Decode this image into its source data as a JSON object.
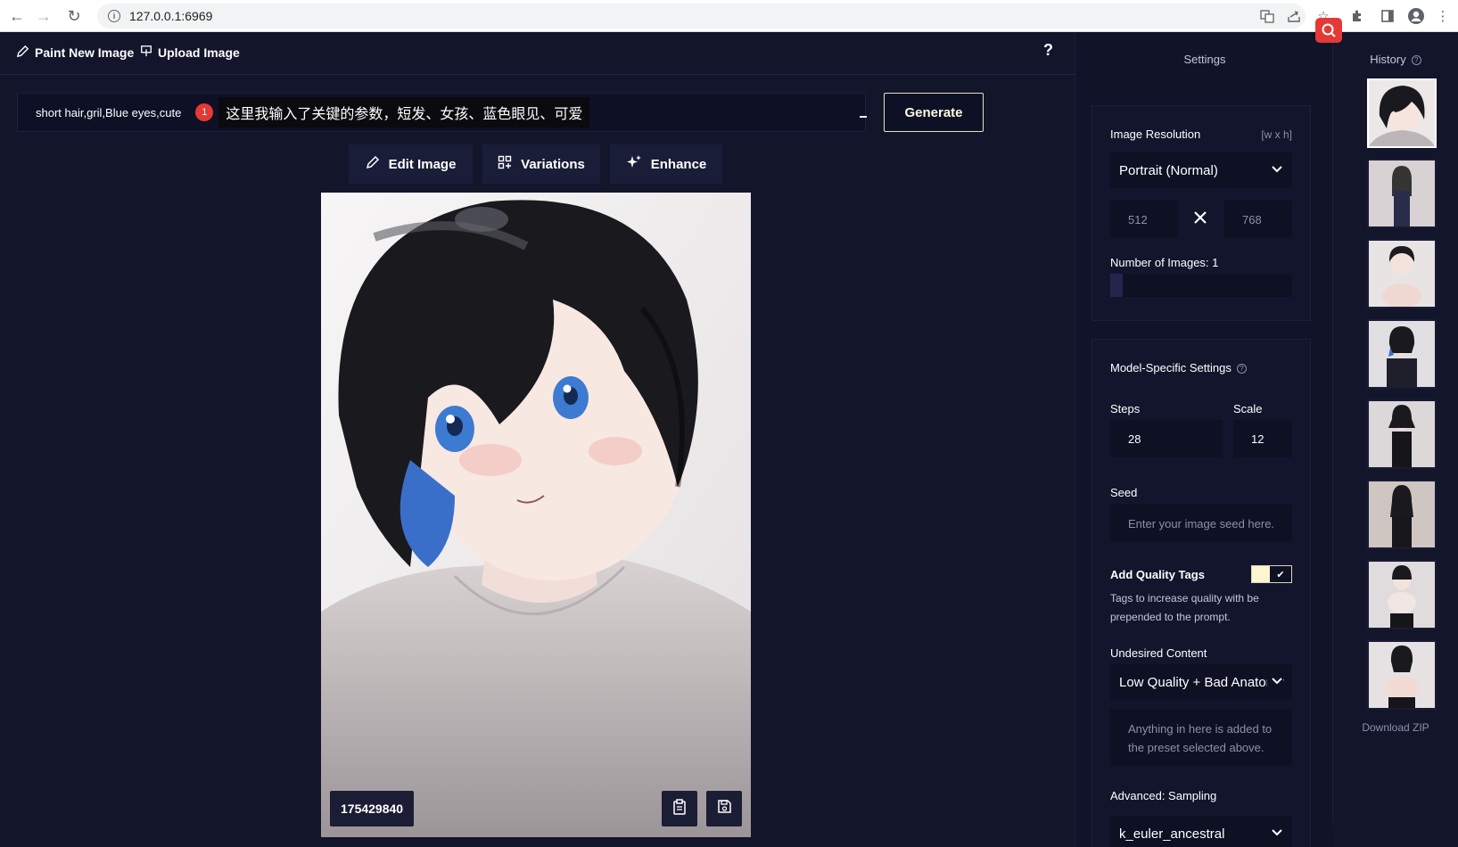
{
  "browser": {
    "url": "127.0.0.1:6969"
  },
  "topbar": {
    "paint_new_label": "Paint New Image",
    "upload_label": "Upload Image",
    "help_label": "?"
  },
  "prompt": {
    "value": "short hair,gril,Blue eyes,cute",
    "badge": "1",
    "annotation": "这里我输入了关键的参数，短发、女孩、蓝色眼见、可爱"
  },
  "generate_label": "Generate",
  "actions": {
    "edit": "Edit Image",
    "variations": "Variations",
    "enhance": "Enhance"
  },
  "image": {
    "seed": "175429840"
  },
  "settings": {
    "title": "Settings",
    "resolution": {
      "label": "Image Resolution",
      "hint": "[w x h]",
      "selected": "Portrait (Normal)",
      "width": "512",
      "height": "768"
    },
    "num_images": {
      "label": "Number of Images:",
      "value": "1",
      "slider_fraction": 0.0
    },
    "model_specific": {
      "label": "Model-Specific Settings",
      "steps_label": "Steps",
      "steps_value": "28",
      "scale_label": "Scale",
      "scale_value": "12",
      "seed_label": "Seed",
      "seed_placeholder": "Enter your image seed here.",
      "quality_tags_label": "Add Quality Tags",
      "quality_tags_desc": "Tags to increase quality with be prepended to the prompt.",
      "quality_tags_on": true,
      "undesired_label": "Undesired Content",
      "undesired_selected": "Low Quality + Bad Anatomy",
      "undesired_placeholder": "Anything in here is added to the preset selected above.",
      "sampling_label": "Advanced: Sampling",
      "sampling_selected": "k_euler_ancestral"
    }
  },
  "history": {
    "title": "History",
    "download_label": "Download ZIP",
    "count": 8
  },
  "colors": {
    "background": "#13152b",
    "accent_red": "#e53935",
    "toggle_on": "#fbf5d0"
  }
}
